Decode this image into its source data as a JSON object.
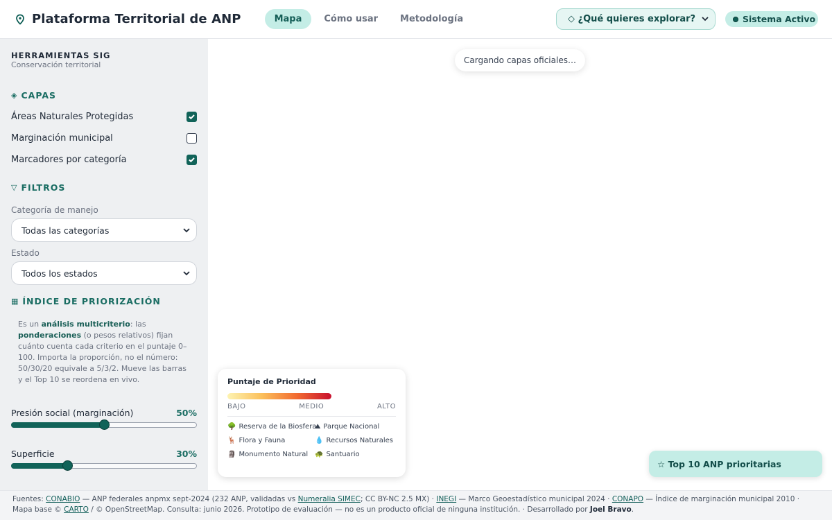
{
  "header": {
    "title": "Plataforma Territorial de ANP",
    "tabs": [
      {
        "label": "Mapa",
        "active": true
      },
      {
        "label": "Cómo usar",
        "active": false
      },
      {
        "label": "Metodología",
        "active": false
      }
    ],
    "explore_label": "◇ ¿Qué quieres explorar?",
    "status_label": "Sistema Activo"
  },
  "sidebar": {
    "title": "HERRAMIENTAS SIG",
    "subtitle": "Conservación territorial",
    "layers_heading": "CAPAS",
    "layers": [
      {
        "label": "Áreas Naturales Protegidas",
        "checked": true
      },
      {
        "label": "Marginación municipal",
        "checked": false
      },
      {
        "label": "Marcadores por categoría",
        "checked": true
      }
    ],
    "filters_heading": "FILTROS",
    "filters": [
      {
        "label": "Categoría de manejo",
        "value": "Todas las categorías"
      },
      {
        "label": "Estado",
        "value": "Todos los estados"
      }
    ],
    "index_heading": "ÍNDICE DE PRIORIZACIÓN",
    "explain": {
      "p1": "Es un ",
      "b1": "análisis multicriterio",
      "p2": ": las ",
      "b2": "ponderaciones",
      "p3": " (o pesos relativos) fijan cuánto cuenta cada criterio en el puntaje 0–100. Importa la proporción, no el número: 50/30/20 equivale a 5/3/2. Mueve las barras y el Top 10 se reordena en vivo."
    },
    "sliders": [
      {
        "label": "Presión social (marginación)",
        "value_label": "50%",
        "value": 0.5
      },
      {
        "label": "Superficie",
        "value_label": "30%",
        "value": 0.3
      }
    ]
  },
  "map": {
    "loading_text": "Cargando capas oficiales…",
    "legend": {
      "title": "Puntaje de Prioridad",
      "scale": [
        "BAJO",
        "MEDIO",
        "ALTO"
      ],
      "categories": [
        {
          "icon": "🌳",
          "label": "Reserva de la Biosfera"
        },
        {
          "icon": "⛰",
          "label": "Parque Nacional"
        },
        {
          "icon": "🦌",
          "label": "Flora y Fauna"
        },
        {
          "icon": "💧",
          "label": "Recursos Naturales"
        },
        {
          "icon": "🗿",
          "label": "Monumento Natural"
        },
        {
          "icon": "🐢",
          "label": "Santuario"
        }
      ]
    },
    "top10_label": "☆ Top 10 ANP prioritarias"
  },
  "footer": {
    "t1": "Fuentes: ",
    "l1": "CONABIO",
    "t2": " — ANP federales anpmx sept-2024 (232 ANP, validadas vs ",
    "l2": "Numeralia SIMEC",
    "t3": "; CC BY-NC 2.5 MX) · ",
    "l3": "INEGI",
    "t4": " — Marco Geoestadístico municipal 2024 · ",
    "l4": "CONAPO",
    "t5": " — Índice de marginación municipal 2010 · Mapa base © ",
    "l5": "CARTO",
    "t6": " / © OpenStreetMap. Consulta: junio 2026. Prototipo de evaluación — no es un producto oficial de ninguna institución. · Desarrollado por ",
    "author": "Joel Bravo",
    "t7": "."
  },
  "colors": {
    "accent": "#116359",
    "accent_light": "#c4ede6",
    "sidebar_bg": "#eef0f2"
  }
}
